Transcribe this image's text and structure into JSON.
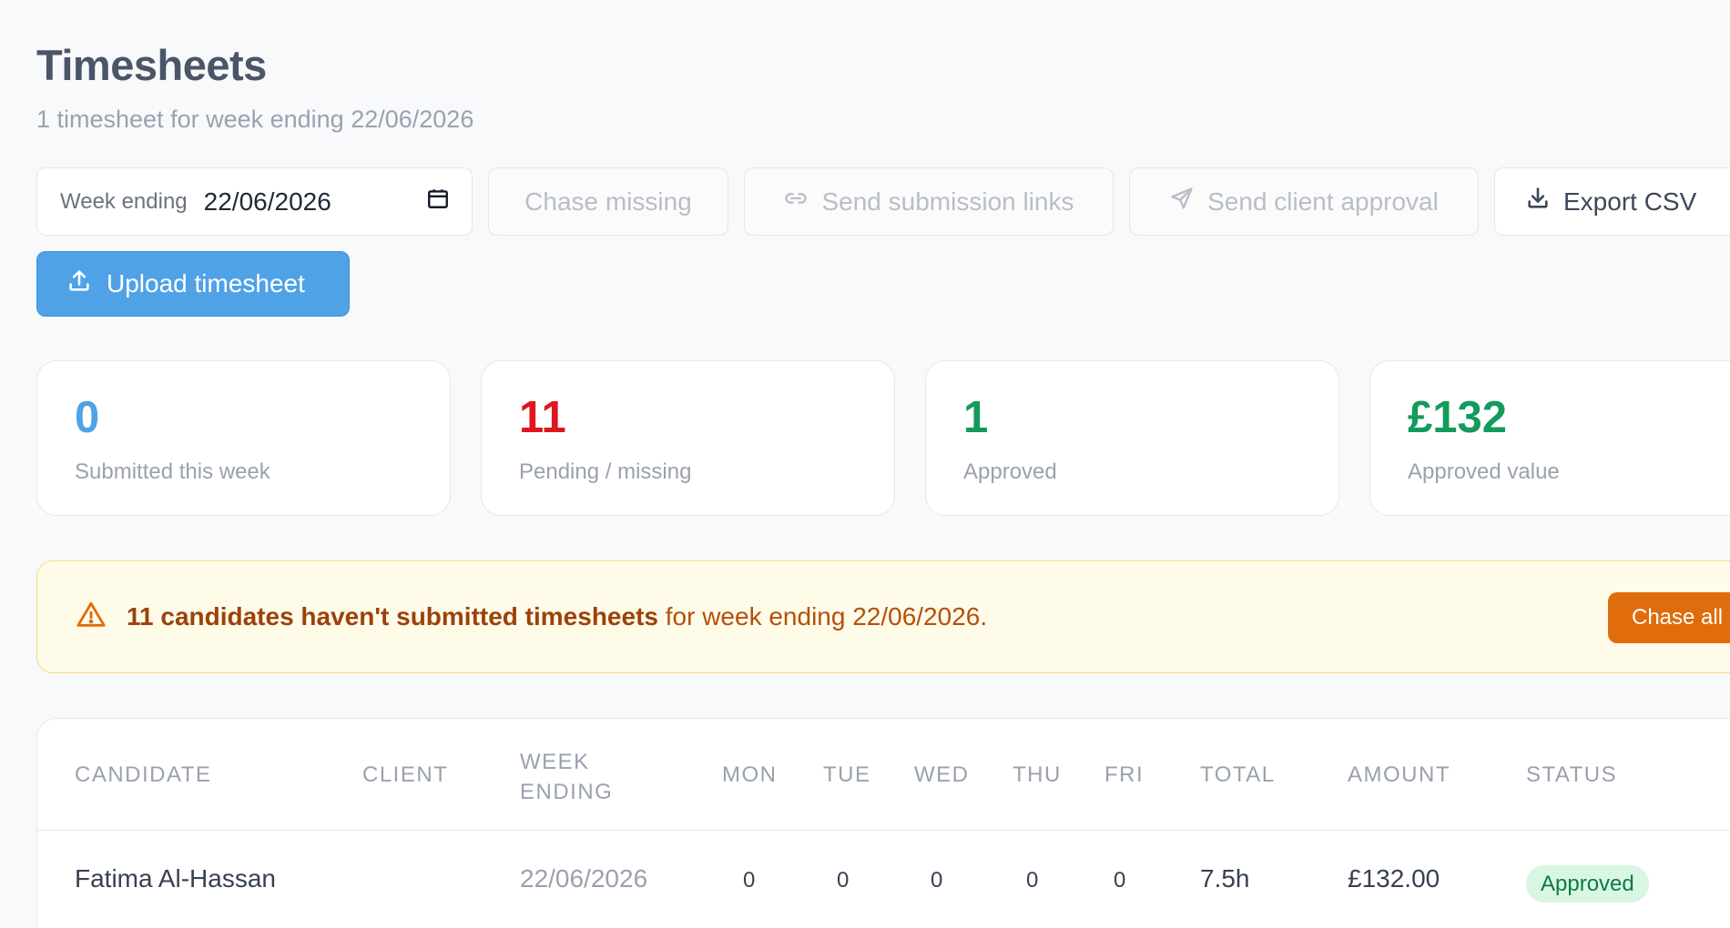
{
  "page": {
    "title": "Timesheets",
    "subtitle": "1 timesheet for week ending 22/06/2026"
  },
  "toolbar": {
    "week_label": "Week ending",
    "week_value": "22/06/2026",
    "chase_missing": "Chase missing",
    "send_links": "Send submission links",
    "send_approval": "Send client approval",
    "export_csv": "Export CSV",
    "upload": "Upload timesheet"
  },
  "stats": [
    {
      "value": "0",
      "label": "Submitted this week",
      "color": "#4fa2e6"
    },
    {
      "value": "11",
      "label": "Pending / missing",
      "color": "#e0161e"
    },
    {
      "value": "1",
      "label": "Approved",
      "color": "#149a5c"
    },
    {
      "value": "£132",
      "label": "Approved value",
      "color": "#149a5c"
    }
  ],
  "alert": {
    "strong": "11 candidates haven't submitted timesheets",
    "rest": " for week ending 22/06/2026.",
    "button": "Chase all"
  },
  "table": {
    "headers": [
      "CANDIDATE",
      "CLIENT",
      "WEEK\nENDING",
      "MON",
      "TUE",
      "WED",
      "THU",
      "FRI",
      "TOTAL",
      "AMOUNT",
      "STATUS"
    ],
    "rows": [
      {
        "candidate": "Fatima Al-Hassan",
        "client": "",
        "week_ending": "22/06/2026",
        "mon": "0",
        "tue": "0",
        "wed": "0",
        "thu": "0",
        "fri": "0",
        "total": "7.5h",
        "amount": "£132.00",
        "status": "Approved"
      }
    ]
  },
  "colors": {
    "primary": "#4fa2e6",
    "warning_bg": "#fefbe9",
    "warning_accent": "#e06c0b"
  }
}
